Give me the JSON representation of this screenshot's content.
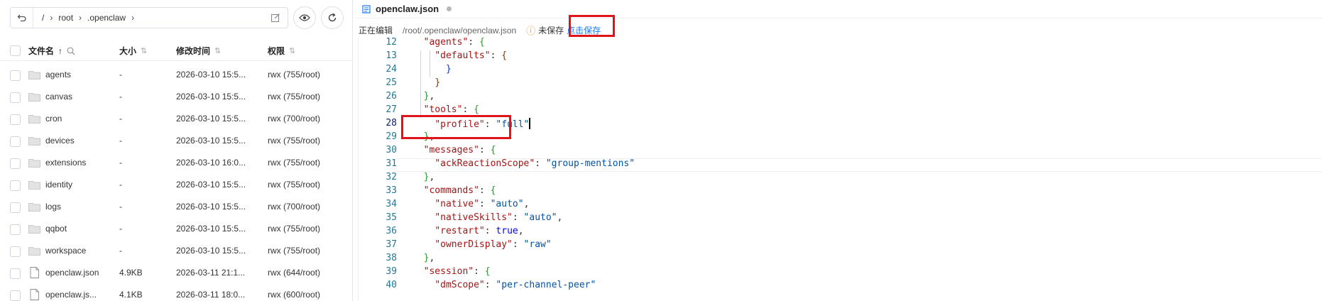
{
  "explorer": {
    "crumbs": [
      "/",
      "root",
      ".openclaw"
    ],
    "headers": {
      "name": "文件名",
      "size": "大小",
      "modified": "修改时间",
      "perm": "权限"
    },
    "rows": [
      {
        "type": "folder",
        "name": "agents",
        "size": "-",
        "modified": "2026-03-10 15:5...",
        "perm": "rwx  (755/root)"
      },
      {
        "type": "folder",
        "name": "canvas",
        "size": "-",
        "modified": "2026-03-10 15:5...",
        "perm": "rwx  (755/root)"
      },
      {
        "type": "folder",
        "name": "cron",
        "size": "-",
        "modified": "2026-03-10 15:5...",
        "perm": "rwx  (700/root)"
      },
      {
        "type": "folder",
        "name": "devices",
        "size": "-",
        "modified": "2026-03-10 15:5...",
        "perm": "rwx  (755/root)"
      },
      {
        "type": "folder",
        "name": "extensions",
        "size": "-",
        "modified": "2026-03-10 16:0...",
        "perm": "rwx  (755/root)"
      },
      {
        "type": "folder",
        "name": "identity",
        "size": "-",
        "modified": "2026-03-10 15:5...",
        "perm": "rwx  (755/root)"
      },
      {
        "type": "folder",
        "name": "logs",
        "size": "-",
        "modified": "2026-03-10 15:5...",
        "perm": "rwx  (700/root)"
      },
      {
        "type": "folder",
        "name": "qqbot",
        "size": "-",
        "modified": "2026-03-10 15:5...",
        "perm": "rwx  (755/root)"
      },
      {
        "type": "folder",
        "name": "workspace",
        "size": "-",
        "modified": "2026-03-10 15:5...",
        "perm": "rwx  (755/root)"
      },
      {
        "type": "file",
        "name": "openclaw.json",
        "size": "4.9KB",
        "modified": "2026-03-11 21:1...",
        "perm": "rwx  (644/root)"
      },
      {
        "type": "file",
        "name": "openclaw.js...",
        "size": "4.1KB",
        "modified": "2026-03-11 18:0...",
        "perm": "rwx  (600/root)"
      }
    ]
  },
  "editor": {
    "tab_title": "openclaw.json",
    "status_editing": "正在编辑",
    "status_path": "/root/.openclaw/openclaw.json",
    "status_warn_icon": "info-circle-icon",
    "status_unsaved": "未保存",
    "status_save_link": "点击保存",
    "line_numbers": [
      "12",
      "13",
      "24",
      "25",
      "26",
      "27",
      "28",
      "29",
      "30",
      "31",
      "32",
      "33",
      "34",
      "35",
      "36",
      "37",
      "38",
      "39",
      "40"
    ],
    "active_line": "28",
    "lines": [
      "  \"agents\": {",
      "    \"defaults\": {",
      "      }",
      "    }",
      "  },",
      "  \"tools\": {",
      "    \"profile\": \"full\"",
      "  },",
      "  \"messages\": {",
      "    \"ackReactionScope\": \"group-mentions\"",
      "  },",
      "  \"commands\": {",
      "    \"native\": \"auto\",",
      "    \"nativeSkills\": \"auto\",",
      "    \"restart\": true,",
      "    \"ownerDisplay\": \"raw\"",
      "  },",
      "  \"session\": {",
      "    \"dmScope\": \"per-channel-peer\""
    ]
  },
  "colors": {
    "accent_link": "#1677ff",
    "warning": "#f59a23",
    "highlight_box": "#e0121a",
    "json_key": "#a31515",
    "json_string": "#0451a5",
    "json_bool": "#0000ff",
    "line_number": "#237893"
  }
}
